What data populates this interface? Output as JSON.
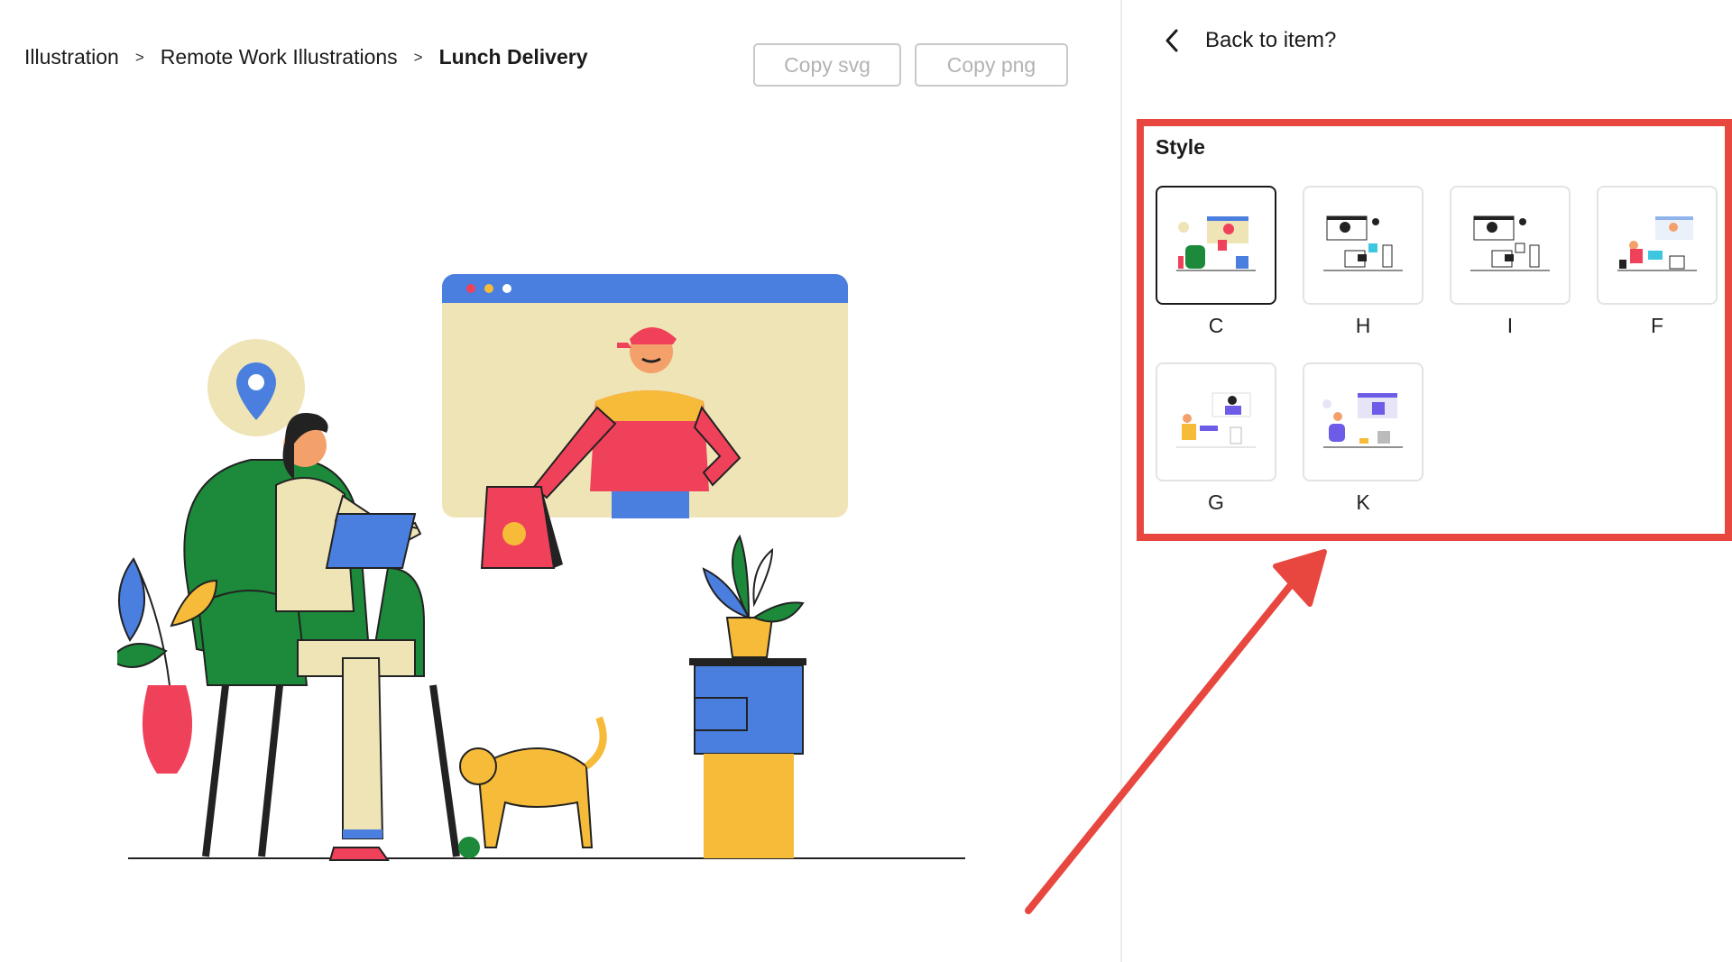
{
  "breadcrumb": {
    "items": [
      "Illustration",
      "Remote Work Illustrations",
      "Lunch Delivery"
    ],
    "separator": ">"
  },
  "toolbar": {
    "copy_svg_label": "Copy svg",
    "copy_png_label": "Copy png"
  },
  "sidebar": {
    "back_label": "Back to item?",
    "style_title": "Style",
    "styles": [
      {
        "label": "C",
        "selected": true
      },
      {
        "label": "H",
        "selected": false
      },
      {
        "label": "I",
        "selected": false
      },
      {
        "label": "F",
        "selected": false
      },
      {
        "label": "G",
        "selected": false
      },
      {
        "label": "K",
        "selected": false
      }
    ]
  },
  "colors": {
    "highlight": "#e8473f",
    "selected_border": "#1a1a1a",
    "disabled_text": "#b3b3b3"
  },
  "icons": {
    "back": "chevron-left-icon",
    "location": "location-pin-icon"
  }
}
